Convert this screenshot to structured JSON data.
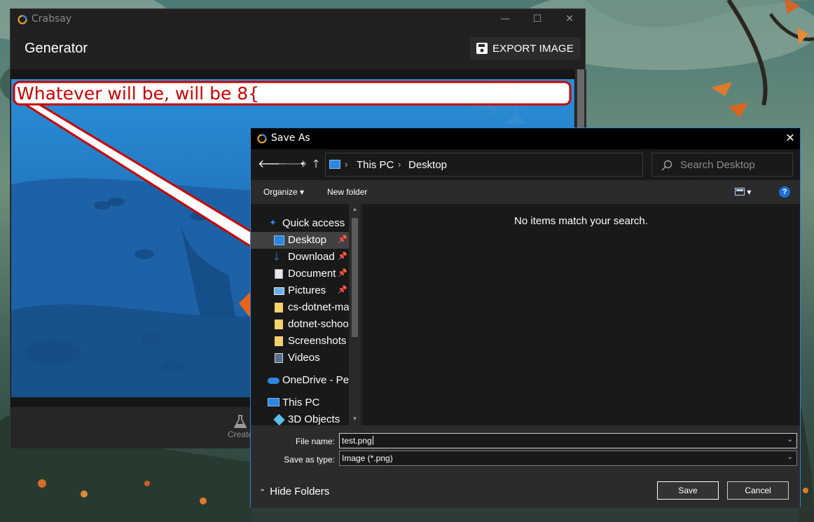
{
  "colors": {
    "accent": "#2f7fd6",
    "dialog_bg": "#191919",
    "caption_text": "#cc0000"
  },
  "crabsay": {
    "window_title": "Crabsay",
    "heading": "Generator",
    "export_label": "EXPORT IMAGE",
    "caption_text": "Whatever will be, will be 8{",
    "bottom_tab_label": "Create"
  },
  "save_as": {
    "title": "Save As",
    "breadcrumb": [
      "This PC",
      "Desktop"
    ],
    "search_placeholder": "Search Desktop",
    "toolbar": {
      "organize": "Organize",
      "new_folder": "New folder"
    },
    "tree": {
      "quick_access": "Quick access",
      "items": [
        {
          "label": "Desktop",
          "icon": "desktop-icon",
          "pinned": true
        },
        {
          "label": "Download",
          "icon": "download-icon",
          "pinned": true
        },
        {
          "label": "Document",
          "icon": "document-icon",
          "pinned": true
        },
        {
          "label": "Pictures",
          "icon": "pictures-icon",
          "pinned": true
        },
        {
          "label": "cs-dotnet-ma",
          "icon": "folder-icon",
          "pinned": false
        },
        {
          "label": "dotnet-schoo",
          "icon": "folder-icon",
          "pinned": false
        },
        {
          "label": "Screenshots",
          "icon": "folder-icon",
          "pinned": false
        },
        {
          "label": "Videos",
          "icon": "videos-icon",
          "pinned": false
        }
      ],
      "onedrive": "OneDrive - Per",
      "this_pc": "This PC",
      "objects_3d": "3D Objects"
    },
    "empty_message": "No items match your search.",
    "file_name_label": "File name:",
    "file_name_value": "test.png",
    "save_type_label": "Save as type:",
    "save_type_value": "Image (*.png)",
    "hide_folders": "Hide Folders",
    "save_button": "Save",
    "cancel_button": "Cancel"
  }
}
